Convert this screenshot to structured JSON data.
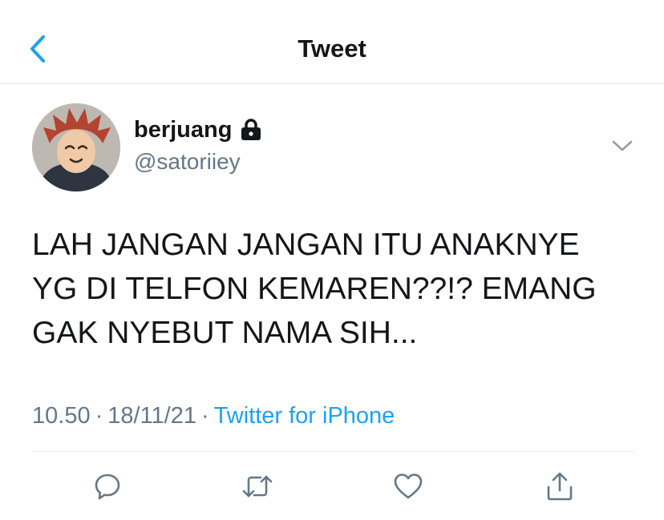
{
  "header": {
    "title": "Tweet"
  },
  "tweet": {
    "display_name": "berjuang",
    "handle": "@satoriiey",
    "text": "LAH JANGAN JANGAN ITU ANAKNYE\nYG DI TELFON KEMAREN??!? EMANG\nGAK NYEBUT NAMA SIH...",
    "time": "10.50",
    "date": "18/11/21",
    "separator": "·",
    "source": "Twitter for iPhone",
    "protected_icon": "lock-icon"
  },
  "icons": {
    "back": "chevron-left-icon",
    "menu": "chevron-down-icon",
    "reply": "reply-icon",
    "retweet": "retweet-icon",
    "like": "heart-icon",
    "share": "share-icon"
  },
  "colors": {
    "accent": "#1da1f2",
    "text": "#14171a",
    "secondary": "#657786",
    "divider": "#e1e8ed"
  }
}
